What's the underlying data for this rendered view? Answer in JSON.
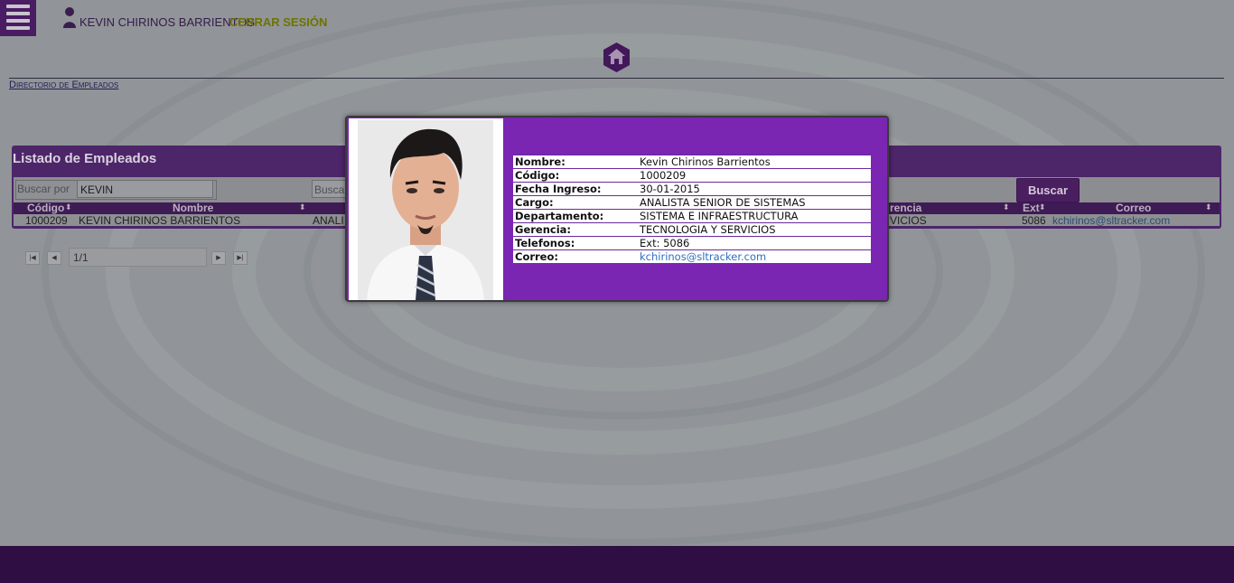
{
  "header": {
    "user_name": "KEVIN CHIRINOS BARRIENTOS",
    "logout_label": "CERRAR SESIÓN"
  },
  "breadcrumb": "Directorio de Empleados",
  "panel": {
    "title": "Listado de Empleados",
    "search_label": "Buscar por",
    "search_value": "KEVIN",
    "search2_placeholder": "Busca",
    "search_button": "Buscar"
  },
  "table": {
    "columns": [
      "Código",
      "Nombre",
      "rencia",
      "Ext",
      "Correo"
    ],
    "rows": [
      {
        "codigo": "1000209",
        "nombre": "KEVIN CHIRINOS BARRIENTOS",
        "cargo_partial": "ANALI",
        "gerencia_partial": "VICIOS",
        "ext": "5086",
        "correo": "kchirinos@sltracker.com"
      }
    ]
  },
  "pager": {
    "page": "1/1"
  },
  "modal": {
    "fields": [
      {
        "label": "Nombre:",
        "value": "Kevin Chirinos Barrientos"
      },
      {
        "label": "Código:",
        "value": "1000209"
      },
      {
        "label": "Fecha Ingreso:",
        "value": "30-01-2015"
      },
      {
        "label": "Cargo:",
        "value": "ANALISTA SENIOR DE SISTEMAS"
      },
      {
        "label": "Departamento:",
        "value": "SISTEMA E INFRAESTRUCTURA"
      },
      {
        "label": "Gerencia:",
        "value": "TECNOLOGIA Y SERVICIOS"
      },
      {
        "label": "Telefonos:",
        "value": "Ext: 5086"
      },
      {
        "label": "Correo:",
        "value": "kchirinos@sltracker.com"
      }
    ]
  },
  "colors": {
    "brand": "#4a1c63",
    "modal_bg": "#7a26b2",
    "footer": "#2f0e44",
    "logout": "#6d7300"
  },
  "icons": [
    "menu-icon",
    "user-icon",
    "home-icon",
    "sort-icon",
    "pager-first-icon",
    "pager-prev-icon",
    "pager-next-icon",
    "pager-last-icon"
  ]
}
